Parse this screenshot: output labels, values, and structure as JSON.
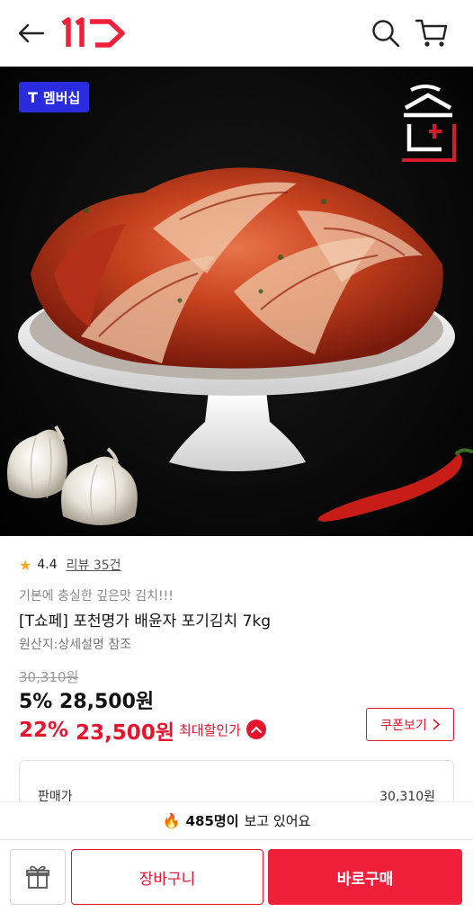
{
  "header": {
    "back_icon": "arrow-left-icon",
    "logo": "11st-logo",
    "search_icon": "search-icon",
    "cart_icon": "cart-icon"
  },
  "hero": {
    "badge_t": "T",
    "badge_label": "멤버십",
    "brand_mark": "brand-logo-mark"
  },
  "rating": {
    "star": "★",
    "score": "4.4",
    "review_label": "리뷰 35건"
  },
  "product": {
    "tagline": "기본에 충실한 깊은맛 김치!!!",
    "title": "[T쇼페] 포천명가 배윤자 포기김치 7kg",
    "origin": "원산지:상세설명 참조"
  },
  "price": {
    "original": "30,310원",
    "discount1_rate": "5%",
    "discount1_price": "28,500원",
    "discount2_rate": "22%",
    "discount2_price": "23,500원",
    "max_discount_label": "최대할인가",
    "coupon_label": "쿠폰보기",
    "sale_label": "판매가",
    "sale_value": "30,310원"
  },
  "viewers": {
    "fire": "🔥",
    "count": "485명이",
    "suffix": "보고 있어요"
  },
  "actions": {
    "gift_icon": "gift-icon",
    "cart_label": "장바구니",
    "buy_label": "바로구매"
  },
  "colors": {
    "accent": "#e8142e",
    "membership": "#2a2adf",
    "star": "#f6a921"
  }
}
